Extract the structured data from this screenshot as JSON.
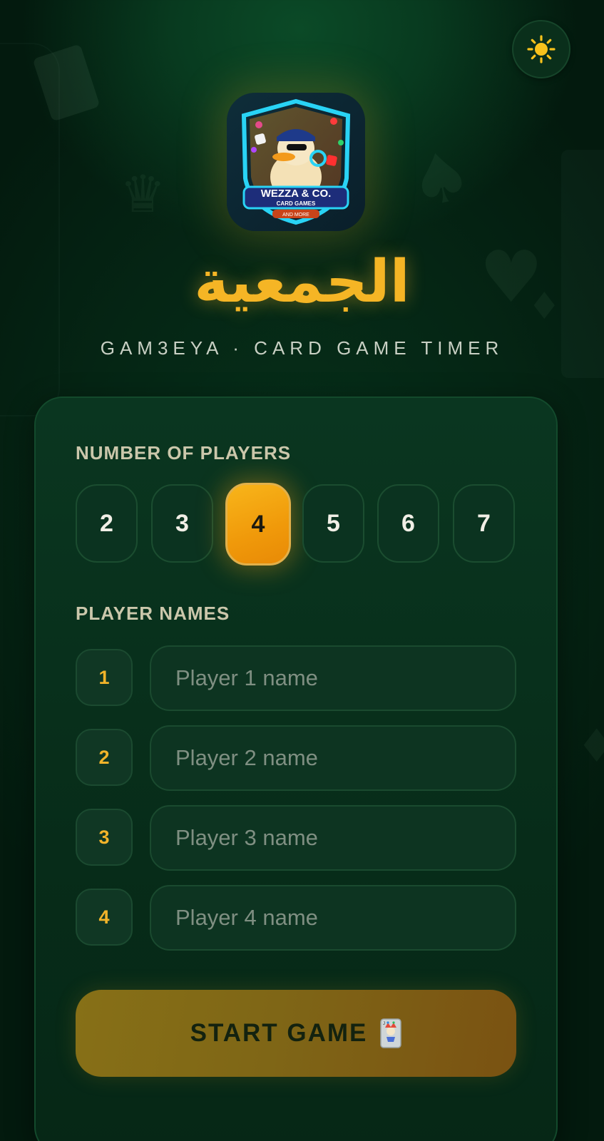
{
  "app": {
    "title_arabic": "الجمعية",
    "subtitle": "GAM3EYA · CARD GAME TIMER"
  },
  "logo": {
    "line1": "WEZZA & CO.",
    "line2": "CARD GAMES",
    "line3": "AND MORE"
  },
  "theme_toggle": {
    "icon": "sun-icon"
  },
  "setup": {
    "players_label": "NUMBER OF PLAYERS",
    "player_counts": [
      "2",
      "3",
      "4",
      "5",
      "6",
      "7"
    ],
    "selected_count": "4",
    "names_label": "PLAYER NAMES",
    "players": [
      {
        "number": "1",
        "value": "",
        "placeholder": "Player 1 name"
      },
      {
        "number": "2",
        "value": "",
        "placeholder": "Player 2 name"
      },
      {
        "number": "3",
        "value": "",
        "placeholder": "Player 3 name"
      },
      {
        "number": "4",
        "value": "",
        "placeholder": "Player 4 name"
      }
    ],
    "start_label": "START GAME",
    "start_icon": "joker-card-icon"
  },
  "colors": {
    "accent": "#f5b525",
    "background": "#052514",
    "card": "#0a3620",
    "selected": "#f8b51a"
  }
}
